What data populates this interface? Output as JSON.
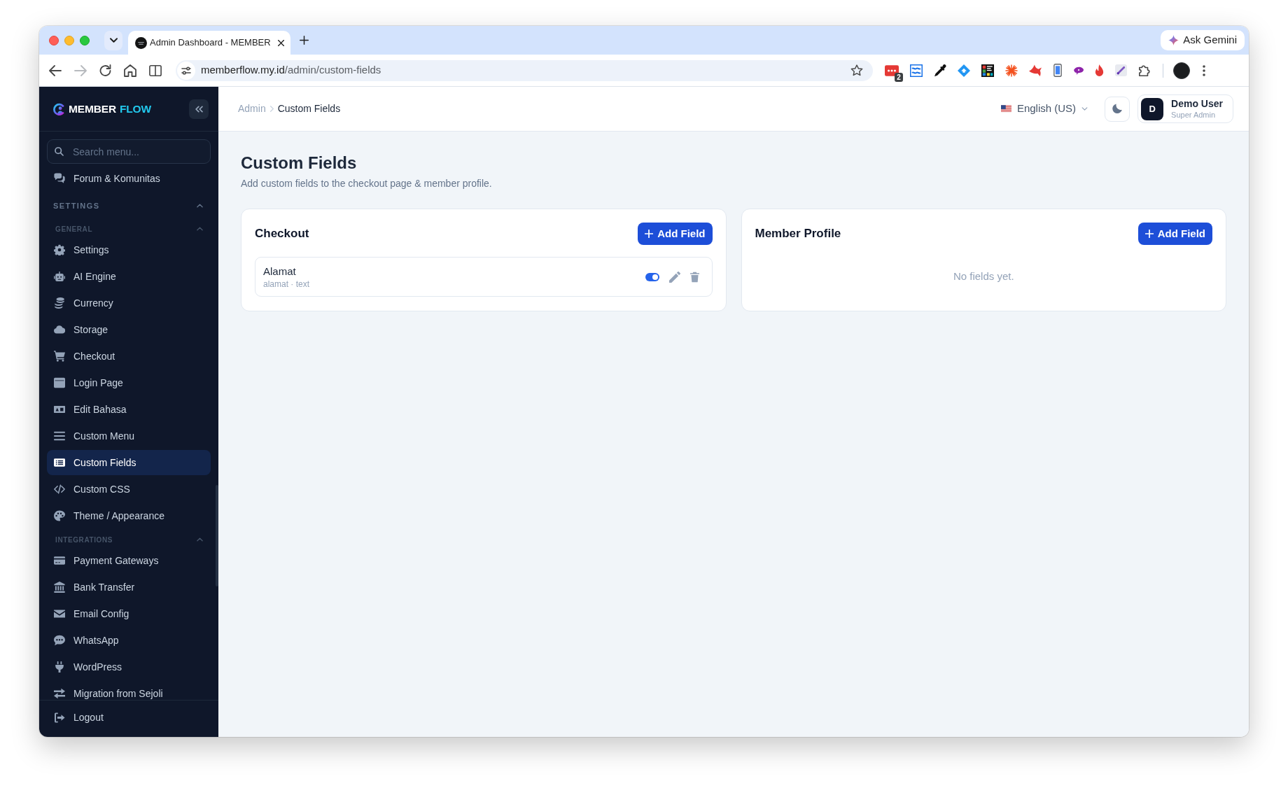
{
  "browser": {
    "tabs": [
      {
        "title": "Admin Dashboard - MEMBER",
        "selected": true
      }
    ],
    "forward_disabled": true,
    "address": {
      "host": "memberflow.my.id",
      "path": "/admin/custom-fields"
    },
    "extension_badge": "2",
    "assistant_button": "Ask Gemini"
  },
  "sidebar": {
    "brand": {
      "name": "MEMBER",
      "accent": "FLOW"
    },
    "search": {
      "placeholder": "Search menu..."
    },
    "nav": [
      {
        "kind": "item",
        "label": "Forum & Komunitas",
        "selected": false
      },
      {
        "kind": "section",
        "label": "SETTINGS",
        "expanded": true,
        "children": [
          {
            "kind": "group",
            "label": "GENERAL",
            "expanded": true,
            "children": [
              {
                "kind": "item",
                "label": "Settings",
                "selected": false
              },
              {
                "kind": "item",
                "label": "AI Engine",
                "selected": false
              },
              {
                "kind": "item",
                "label": "Currency",
                "selected": false
              },
              {
                "kind": "item",
                "label": "Storage",
                "selected": false
              },
              {
                "kind": "item",
                "label": "Checkout",
                "selected": false
              },
              {
                "kind": "item",
                "label": "Login Page",
                "selected": false
              },
              {
                "kind": "item",
                "label": "Edit Bahasa",
                "selected": false
              },
              {
                "kind": "item",
                "label": "Custom Menu",
                "selected": false
              },
              {
                "kind": "item",
                "label": "Custom Fields",
                "selected": true
              },
              {
                "kind": "item",
                "label": "Custom CSS",
                "selected": false
              },
              {
                "kind": "item",
                "label": "Theme / Appearance",
                "selected": false
              }
            ]
          },
          {
            "kind": "group",
            "label": "INTEGRATIONS",
            "expanded": true,
            "children": [
              {
                "kind": "item",
                "label": "Payment Gateways",
                "selected": false
              },
              {
                "kind": "item",
                "label": "Bank Transfer",
                "selected": false
              },
              {
                "kind": "item",
                "label": "Email Config",
                "selected": false
              },
              {
                "kind": "item",
                "label": "WhatsApp",
                "selected": false
              },
              {
                "kind": "item",
                "label": "WordPress",
                "selected": false
              },
              {
                "kind": "item",
                "label": "Migration from Sejoli",
                "selected": false
              }
            ]
          }
        ]
      }
    ],
    "footer_item": {
      "label": "Logout"
    }
  },
  "header": {
    "breadcrumb": [
      "Admin",
      "Custom Fields"
    ],
    "language": "English (US)",
    "user": {
      "initial": "D",
      "name": "Demo User",
      "role": "Super Admin"
    }
  },
  "page": {
    "title": "Custom Fields",
    "subtitle": "Add custom fields to the checkout page & member profile.",
    "panels": [
      {
        "title": "Checkout",
        "add_button": "Add Field",
        "fields": [
          {
            "label": "Alamat",
            "meta": "alamat · text",
            "on": true
          }
        ]
      },
      {
        "title": "Member Profile",
        "add_button": "Add Field",
        "empty_text": "No fields yet."
      }
    ]
  }
}
